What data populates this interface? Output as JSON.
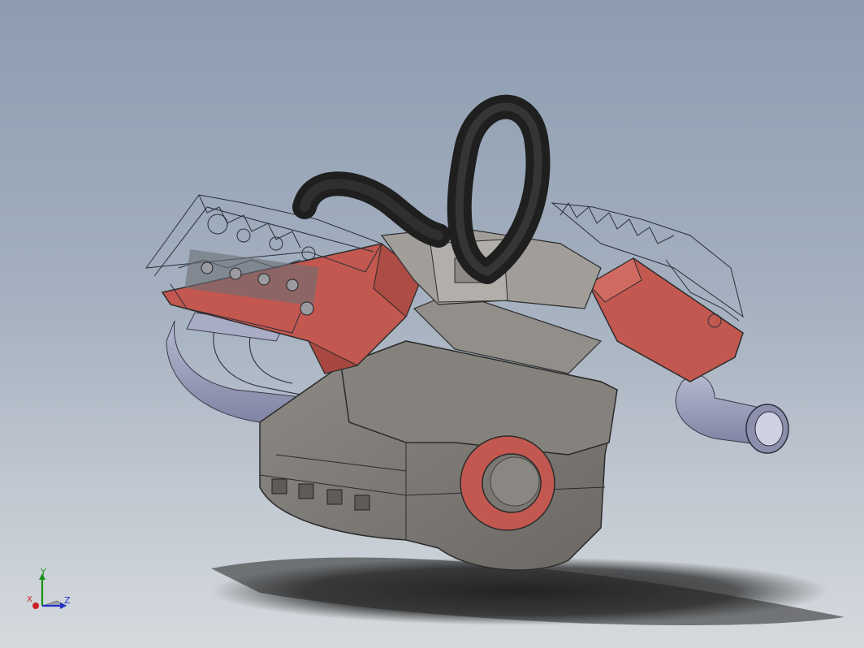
{
  "viewport": {
    "background_top": "#8d9cb1",
    "background_bottom": "#d5dade",
    "model_colors": {
      "block": "#7d7a75",
      "head": "#c2584f",
      "valve_cover": "#dfe3ea",
      "hose": "#2a2a2a",
      "exhaust": "#9b9eb8",
      "pulley_ring": "#c2584f"
    }
  },
  "triad": {
    "y_label": "Y",
    "z_label": "Z",
    "x_label": "X",
    "y_color": "#1b8f1b",
    "z_color": "#2432c9",
    "x_color": "#c81f1f"
  }
}
